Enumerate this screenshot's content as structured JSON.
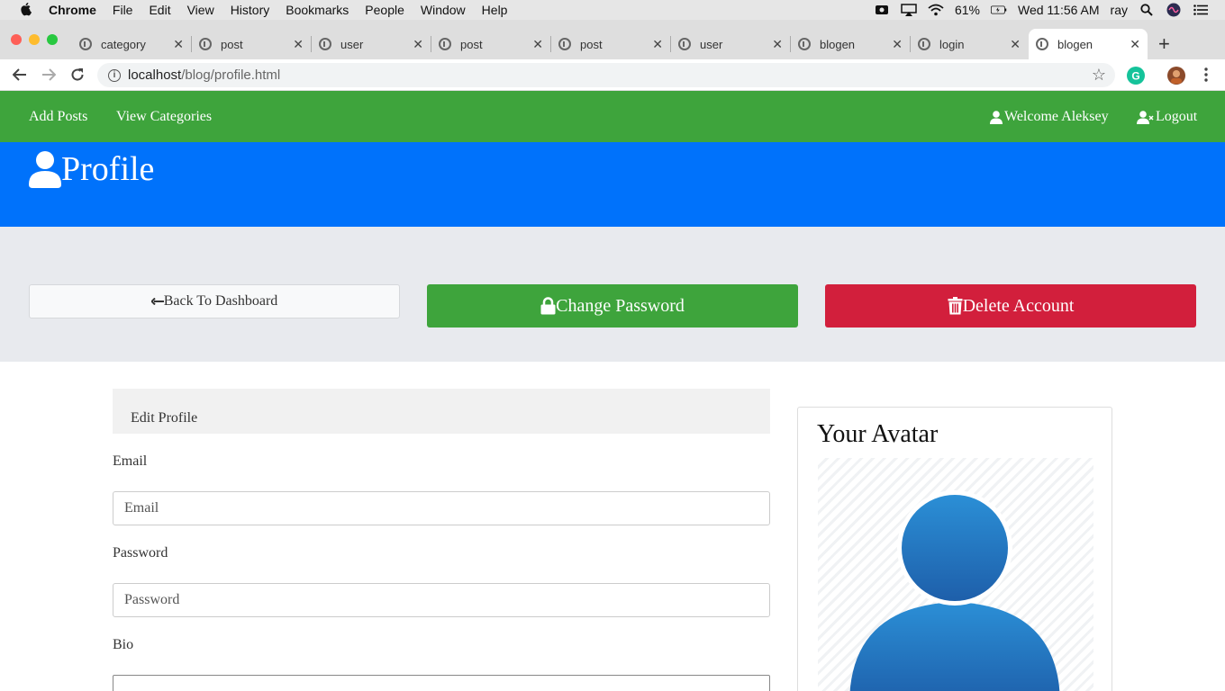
{
  "macos": {
    "app_name": "Chrome",
    "menu": [
      "File",
      "Edit",
      "View",
      "History",
      "Bookmarks",
      "People",
      "Window",
      "Help"
    ],
    "battery": "61%",
    "clock": "Wed 11:56 AM",
    "user": "ray"
  },
  "browser": {
    "tabs": [
      {
        "title": "category"
      },
      {
        "title": "post"
      },
      {
        "title": "user"
      },
      {
        "title": "post"
      },
      {
        "title": "post"
      },
      {
        "title": "user"
      },
      {
        "title": "blogen"
      },
      {
        "title": "login"
      },
      {
        "title": "blogen",
        "active": true
      }
    ],
    "url_host": "localhost",
    "url_path": "/blog/profile.html"
  },
  "nav": {
    "add_posts": "Add Posts",
    "view_categories": "View Categories",
    "welcome": "Welcome Aleksey",
    "logout": "Logout"
  },
  "hero": {
    "title": "Profile"
  },
  "actions": {
    "back": "Back To Dashboard",
    "change_password": "Change Password",
    "delete_account": "Delete Account"
  },
  "form": {
    "header": "Edit Profile",
    "email_label": "Email",
    "email_placeholder": "Email",
    "password_label": "Password",
    "password_placeholder": "Password",
    "bio_label": "Bio"
  },
  "avatar": {
    "title": "Your Avatar"
  },
  "colors": {
    "nav_green": "#3ea43c",
    "hero_blue": "#0072fb",
    "danger_red": "#d21f3c"
  }
}
